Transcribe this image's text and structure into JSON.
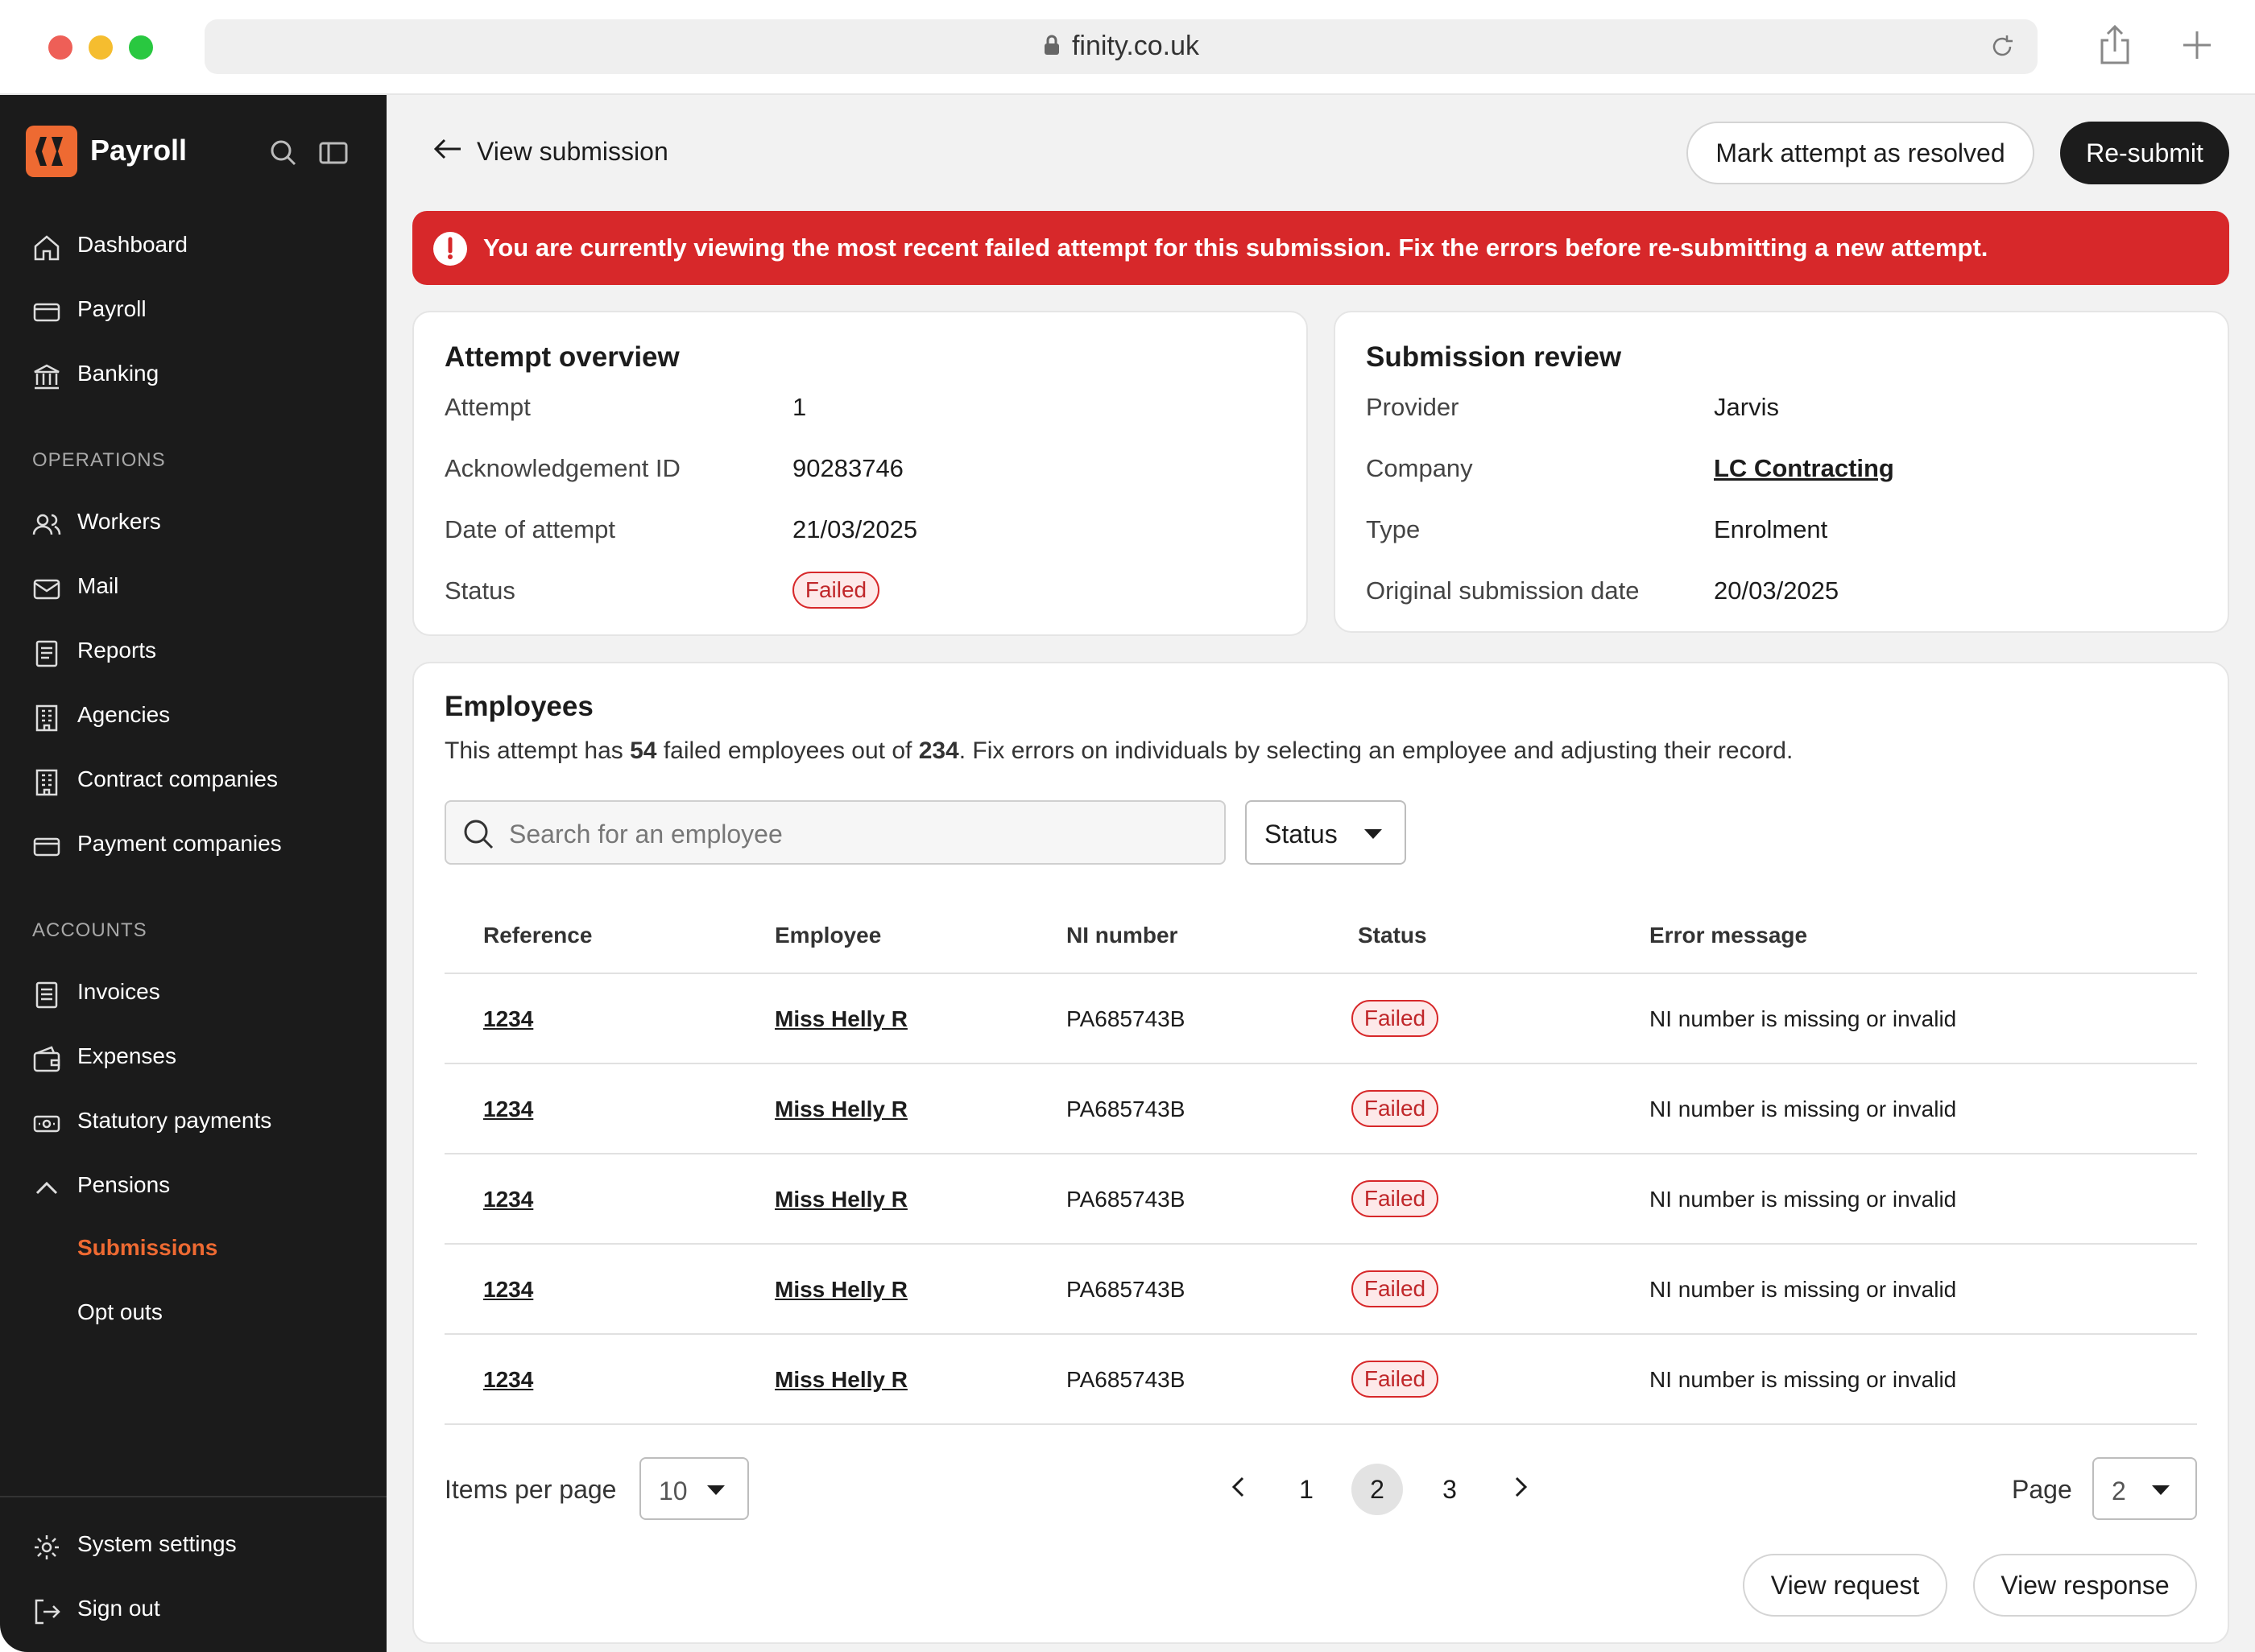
{
  "browser": {
    "url": "finity.co.uk"
  },
  "app": {
    "name": "Payroll"
  },
  "sidebar": {
    "main_items": [
      {
        "label": "Dashboard",
        "icon": "home-icon"
      },
      {
        "label": "Payroll",
        "icon": "card-icon"
      },
      {
        "label": "Banking",
        "icon": "bank-icon"
      }
    ],
    "operations_heading": "OPERATIONS",
    "operations_items": [
      {
        "label": "Workers",
        "icon": "users-icon"
      },
      {
        "label": "Mail",
        "icon": "mail-icon"
      },
      {
        "label": "Reports",
        "icon": "document-icon"
      },
      {
        "label": "Agencies",
        "icon": "building-icon"
      },
      {
        "label": "Contract companies",
        "icon": "building-icon"
      },
      {
        "label": "Payment companies",
        "icon": "card-icon"
      }
    ],
    "accounts_heading": "ACCOUNTS",
    "accounts_items": [
      {
        "label": "Invoices",
        "icon": "receipt-icon"
      },
      {
        "label": "Expenses",
        "icon": "wallet-icon"
      },
      {
        "label": "Statutory payments",
        "icon": "cash-icon"
      },
      {
        "label": "Pensions",
        "icon": "chevron-up-icon"
      }
    ],
    "pensions_sub": [
      "Submissions",
      "Opt outs"
    ],
    "bottom_items": [
      {
        "label": "System settings",
        "icon": "gear-icon"
      },
      {
        "label": "Sign out",
        "icon": "sign-out-icon"
      }
    ]
  },
  "header": {
    "back_label": "View submission",
    "mark_resolved": "Mark attempt as resolved",
    "resubmit": "Re-submit"
  },
  "alert": {
    "text": "You are currently viewing the most recent failed attempt for this submission. Fix the errors before re-submitting a new attempt."
  },
  "attempt_overview": {
    "title": "Attempt overview",
    "rows": [
      {
        "k": "Attempt",
        "v": "1"
      },
      {
        "k": "Acknowledgement ID",
        "v": "90283746"
      },
      {
        "k": "Date of attempt",
        "v": "21/03/2025"
      },
      {
        "k": "Status",
        "v": "Failed"
      }
    ]
  },
  "submission_review": {
    "title": "Submission review",
    "rows": [
      {
        "k": "Provider",
        "v": "Jarvis"
      },
      {
        "k": "Company",
        "v": "LC Contracting"
      },
      {
        "k": "Type",
        "v": "Enrolment"
      },
      {
        "k": "Original submission date",
        "v": "20/03/2025"
      }
    ]
  },
  "employees": {
    "title": "Employees",
    "desc_a": "This attempt has ",
    "failed_count": "54",
    "desc_b": " failed employees out of ",
    "total_count": "234",
    "desc_c": ". Fix errors on individuals by selecting an employee and adjusting their record.",
    "search_placeholder": "Search for an employee",
    "status_filter": "Status",
    "columns": [
      "Reference",
      "Employee",
      "NI number",
      "Status",
      "Error message"
    ],
    "rows": [
      {
        "ref": "1234",
        "name": "Miss Helly R",
        "ni": "PA685743B",
        "status": "Failed",
        "error": "NI number is missing or invalid"
      },
      {
        "ref": "1234",
        "name": "Miss Helly R",
        "ni": "PA685743B",
        "status": "Failed",
        "error": "NI number is missing or invalid"
      },
      {
        "ref": "1234",
        "name": "Miss Helly R",
        "ni": "PA685743B",
        "status": "Failed",
        "error": "NI number is missing or invalid"
      },
      {
        "ref": "1234",
        "name": "Miss Helly R",
        "ni": "PA685743B",
        "status": "Failed",
        "error": "NI number is missing or invalid"
      },
      {
        "ref": "1234",
        "name": "Miss Helly R",
        "ni": "PA685743B",
        "status": "Failed",
        "error": "NI number is missing or invalid"
      }
    ]
  },
  "pagination": {
    "items_per_page_label": "Items per page",
    "items_per_page": "10",
    "pages": [
      "1",
      "2",
      "3"
    ],
    "current_page": "2",
    "page_label": "Page",
    "page_select": "2"
  },
  "footer_actions": {
    "view_request": "View request",
    "view_response": "View response"
  },
  "colors": {
    "accent": "#ee6a32",
    "danger": "#d7282a",
    "sidebar": "#1b1b1b"
  }
}
